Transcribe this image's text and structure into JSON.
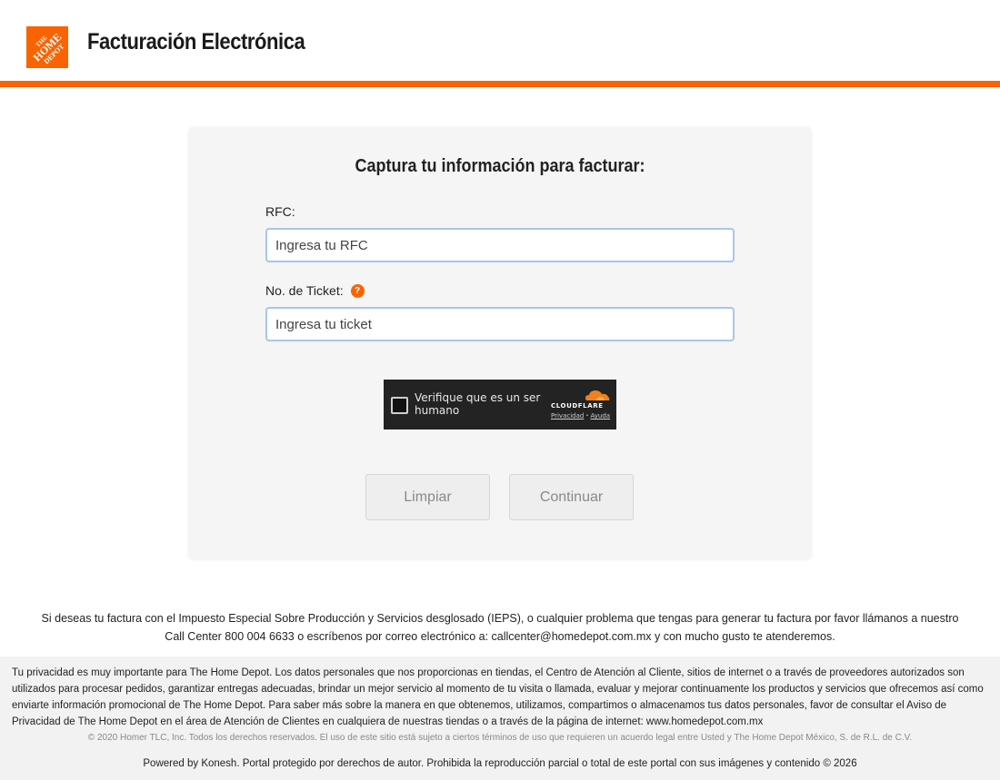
{
  "header": {
    "title": "Facturación Electrónica",
    "logo_text": "THE HOME DEPOT",
    "accent_color": "#f96302"
  },
  "form": {
    "title": "Captura tu información para facturar:",
    "rfc_label": "RFC:",
    "rfc_value": "",
    "rfc_placeholder": "Ingresa tu RFC",
    "ticket_label": "No. de Ticket:",
    "ticket_help_icon": "question-icon",
    "ticket_value": "",
    "ticket_placeholder": "Ingresa tu ticket"
  },
  "captcha": {
    "text": "Verifique que es un ser humano",
    "brand": "CLOUDFLARE",
    "privacy_link": "Privacidad",
    "separator": "·",
    "help_link": "Ayuda"
  },
  "buttons": {
    "clear": "Limpiar",
    "continue": "Continuar"
  },
  "notice": {
    "text": "Si deseas tu factura con el Impuesto Especial Sobre Producción y Servicios desglosado (IEPS), o cualquier problema que tengas para generar tu factura por favor llámanos a nuestro Call Center 800 004 6633 o escríbenos por correo electrónico a: callcenter@homedepot.com.mx y con mucho gusto te atenderemos."
  },
  "footer": {
    "privacy": "Tu privacidad es muy importante para The Home Depot. Los datos personales que nos proporcionas en tiendas, el Centro de Atención al Cliente, sitios de internet o a través de proveedores autorizados son utilizados para procesar pedidos, garantizar entregas adecuadas, brindar un mejor servicio al momento de tu visita o llamada, evaluar y mejorar continuamente los productos y servicios que ofrecemos así como enviarte información promocional de The Home Depot. Para saber más sobre la manera en que obtenemos, utilizamos, compartimos o almacenamos tus datos personales, favor de consultar el Aviso de Privacidad de The Home Depot en el área de Atención de Clientes en cualquiera de nuestras tiendas o a través de la página de internet: www.homedepot.com.mx",
    "copyright": "© 2020 Homer TLC, Inc. Todos los derechos reservados. El uso de este sitio está sujeto a ciertos términos de uso que requieren un acuerdo legal entre Usted y The Home Depot México, S. de R.L. de C.V.",
    "powered": "Powered by Konesh. Portal protegido por derechos de autor. Prohibida la reproducción parcial o total de este portal con sus imágenes y contenido © 2026"
  }
}
